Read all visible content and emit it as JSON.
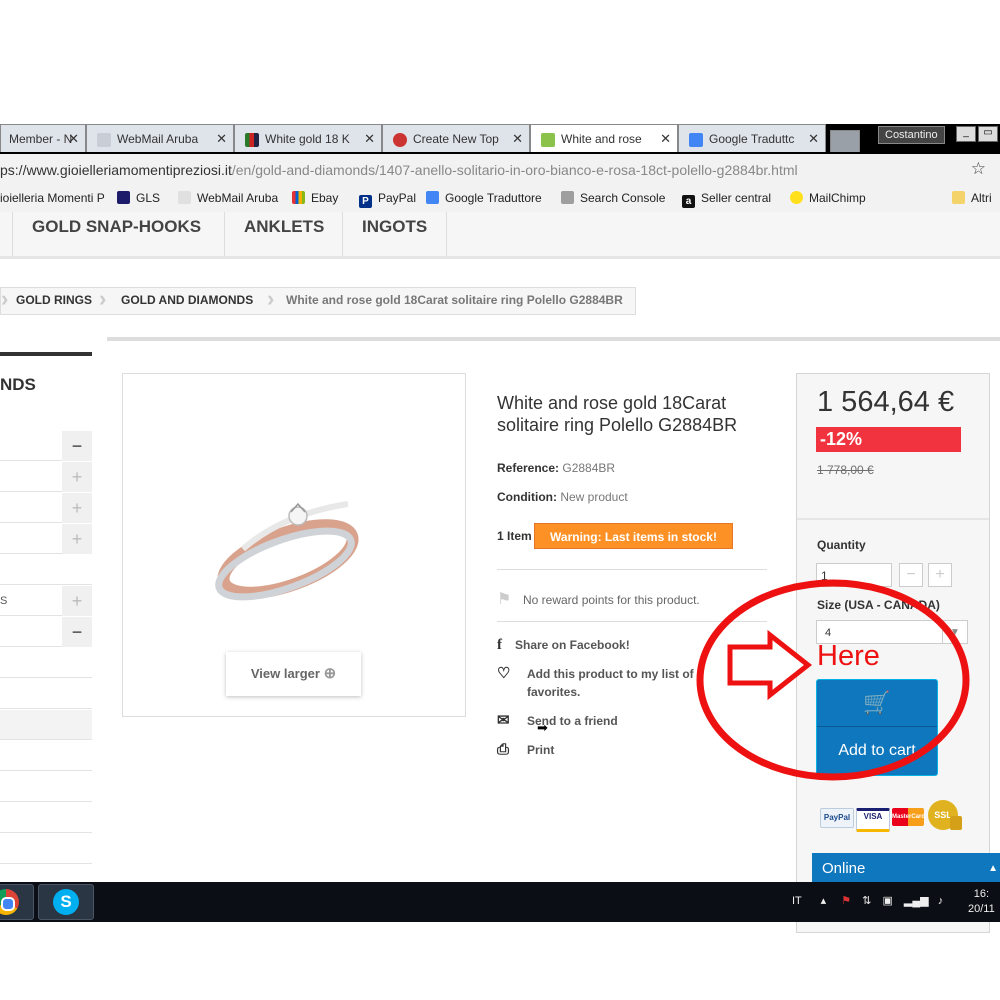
{
  "browser": {
    "tabs": [
      {
        "label": "Member - N",
        "active": false
      },
      {
        "label": "WebMail Aruba",
        "active": false
      },
      {
        "label": "White gold 18 K",
        "active": false
      },
      {
        "label": "Create New Top",
        "active": false
      },
      {
        "label": "White and rose",
        "active": true
      },
      {
        "label": "Google Traduttc",
        "active": false
      }
    ],
    "user": "Costantino",
    "url_scheme": "ps://",
    "url_host": "www.gioielleriamomentipreziosi.it",
    "url_path": "/en/gold-and-diamonds/1407-anello-solitario-in-oro-bianco-e-rosa-18ct-polello-g2884br.html",
    "bookmarks": [
      "ioielleria Momenti P",
      "GLS",
      "WebMail Aruba",
      "Ebay",
      "PayPal",
      "Google Traduttore",
      "Search Console",
      "Seller central",
      "MailChimp",
      "Altri"
    ]
  },
  "nav": [
    "GOLD SNAP-HOOKS",
    "ANKLETS",
    "INGOTS"
  ],
  "breadcrumb": [
    "GOLD RINGS",
    "GOLD AND DIAMONDS",
    "White and rose gold 18Carat solitaire ring Polello G2884BR"
  ],
  "left": {
    "title": "NDS",
    "rows": [
      {
        "label": "",
        "toggle": "−"
      },
      {
        "label": "",
        "toggle": "+"
      },
      {
        "label": "",
        "toggle": "+"
      },
      {
        "label": "",
        "toggle": "+"
      },
      {
        "label": "",
        "toggle": ""
      },
      {
        "label": "S",
        "toggle": "+"
      },
      {
        "label": "",
        "toggle": "−"
      },
      {
        "label": "",
        "toggle": ""
      },
      {
        "label": "",
        "toggle": ""
      },
      {
        "label": "",
        "toggle": ""
      },
      {
        "label": "",
        "toggle": ""
      },
      {
        "label": "",
        "toggle": ""
      },
      {
        "label": "",
        "toggle": ""
      },
      {
        "label": "",
        "toggle": ""
      }
    ]
  },
  "product": {
    "title": "White and rose gold 18Carat solitaire ring Polello G2884BR",
    "view_larger": "View larger",
    "reference_label": "Reference:",
    "reference_value": "G2884BR",
    "condition_label": "Condition:",
    "condition_value": "New product",
    "items_label": "1 Item",
    "stock_warning": "Warning: Last items in stock!",
    "reward_text": "No reward points for this product.",
    "share_facebook": "Share on Facebook!",
    "add_favorites": "Add this product to my list of favorites.",
    "send_friend": "Send to a friend",
    "print": "Print"
  },
  "buy": {
    "price": "1 564,64 €",
    "discount": "-12%",
    "old_price": "1 778,00 €",
    "quantity_label": "Quantity",
    "quantity_value": "1",
    "size_label": "Size (USA - CANADA)",
    "size_value": "4",
    "add_to_cart": "Add to cart",
    "payment_methods": [
      "PayPal",
      "VISA",
      "MasterCard",
      "SSL"
    ],
    "online": "Online"
  },
  "annotation": {
    "text": "Here",
    "color": "#ee1111"
  },
  "taskbar": {
    "language": "IT",
    "time": "16:",
    "date": "20/11"
  }
}
